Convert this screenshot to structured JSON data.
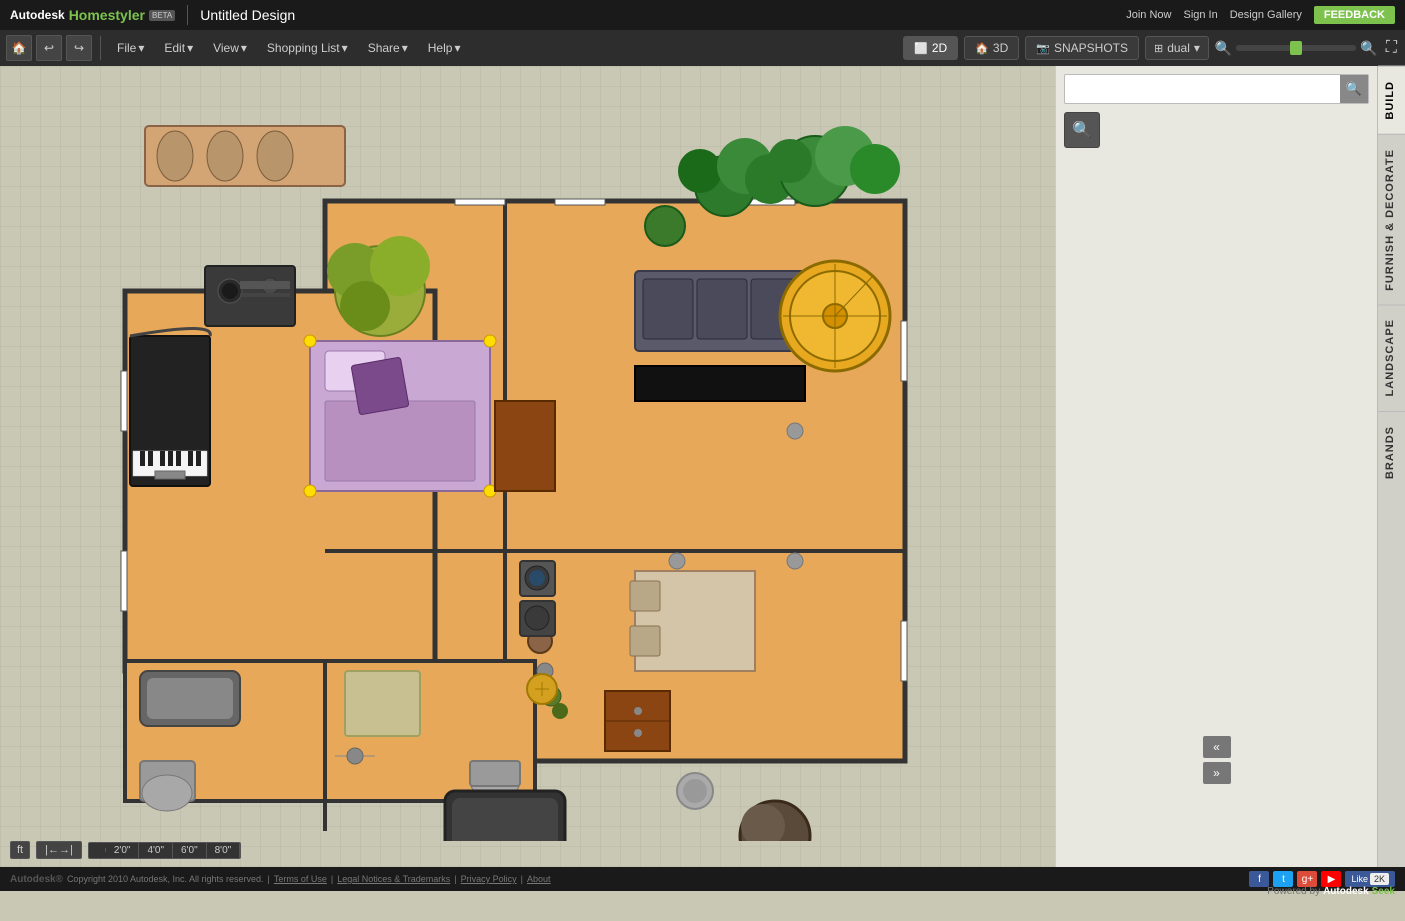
{
  "topBar": {
    "autodesk": "Autodesk",
    "homestyler": "Homestyler",
    "beta": "BETA",
    "designTitle": "Untitled Design",
    "joinNow": "Join Now",
    "signIn": "Sign In",
    "designGallery": "Design Gallery",
    "feedback": "FEEDBACK"
  },
  "toolbar": {
    "menus": [
      "File",
      "Edit",
      "View",
      "Shopping List",
      "Share",
      "Help"
    ],
    "view2d": "2D",
    "view3d": "3D",
    "snapshots": "SNAPSHOTS",
    "dual": "dual"
  },
  "rightPanel": {
    "tabs": [
      "BUILD",
      "FURNISH & DECORATE",
      "LANDSCAPE",
      "BRANDS"
    ],
    "searchPlaceholder": ""
  },
  "bottomBar": {
    "unit": "ft",
    "scale": [
      "2'0\"",
      "4'0\"",
      "6'0\"",
      "8'0\""
    ],
    "poweredBy": "Powered by",
    "autodesk": "Autodesk",
    "seek": "Seek"
  },
  "footer": {
    "copyright": "Copyright 2010 Autodesk, Inc. All rights reserved.",
    "termsOfUse": "Terms of Use",
    "legalNotices": "Legal Notices & Trademarks",
    "privacyPolicy": "Privacy Policy",
    "about": "About",
    "likeLabel": "Like",
    "likeCount": "2K"
  }
}
